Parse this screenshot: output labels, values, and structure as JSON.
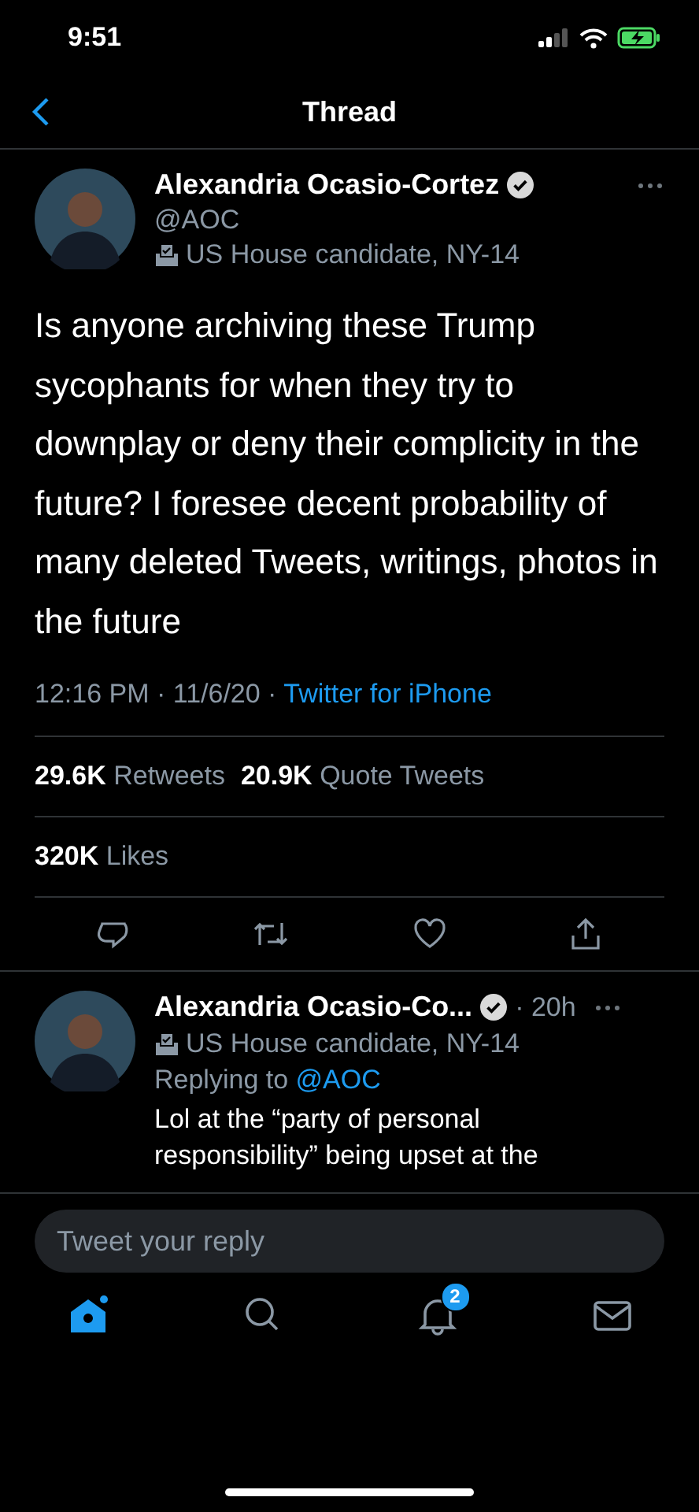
{
  "status_bar": {
    "time": "9:51"
  },
  "nav": {
    "title": "Thread"
  },
  "tweet": {
    "name": "Alexandria Ocasio-Cortez",
    "verified": true,
    "handle": "@AOC",
    "label": "US House candidate, NY-14",
    "text": "Is anyone archiving these Trump sycophants for when they try to downplay or deny their complicity in the future? I foresee decent probability of many deleted Tweets, writings, photos in the future",
    "time": "12:16 PM · 11/6/20 · ",
    "source": "Twitter for iPhone",
    "stats": [
      {
        "count": "29.6K",
        "label": "Retweets"
      },
      {
        "count": "20.9K",
        "label": "Quote Tweets"
      }
    ],
    "likes": {
      "count": "320K",
      "label": "Likes"
    }
  },
  "reply": {
    "name": "Alexandria Ocasio-Co...",
    "verified": true,
    "age": "· 20h",
    "label": "US House candidate, NY-14",
    "replying_prefix": "Replying to ",
    "replying_to": "@AOC",
    "text": "Lol at the “party of personal responsibility” being upset at the"
  },
  "composer": {
    "placeholder": "Tweet your reply"
  },
  "tab_bar": [
    {
      "kind": "home",
      "selected": true
    },
    {
      "kind": "search",
      "selected": false
    },
    {
      "kind": "notifications",
      "selected": false,
      "badge": "2"
    },
    {
      "kind": "messages",
      "selected": false
    }
  ]
}
